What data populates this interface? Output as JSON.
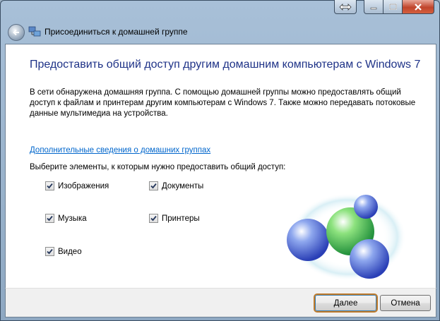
{
  "window": {
    "title": "Присоединиться к домашней группе",
    "caption_buttons": [
      "help",
      "minimize",
      "maximize",
      "close"
    ]
  },
  "heading": "Предоставить общий доступ другим домашним компьютерам с Windows 7",
  "description": "В сети обнаружена домашняя группа. С помощью домашней группы можно предоставлять общий доступ к файлам и принтерам другим компьютерам с Windows 7. Также можно передавать потоковые данные мультимедиа на устройства.",
  "link_text": "Дополнительные сведения о домашних группах",
  "prompt": "Выберите элементы, к которым нужно предоставить общий доступ:",
  "options": [
    {
      "label": "Изображения",
      "checked": true
    },
    {
      "label": "Документы",
      "checked": true
    },
    {
      "label": "Музыка",
      "checked": true
    },
    {
      "label": "Принтеры",
      "checked": true
    },
    {
      "label": "Видео",
      "checked": true
    }
  ],
  "buttons": {
    "next": "Далее",
    "cancel": "Отмена"
  },
  "colors": {
    "heading": "#1e3287",
    "link": "#0066cc",
    "accent_focus": "#c07a2a"
  },
  "icons": [
    "back-arrow-icon",
    "homegroup-network-icon",
    "homegroup-spheres-logo"
  ]
}
